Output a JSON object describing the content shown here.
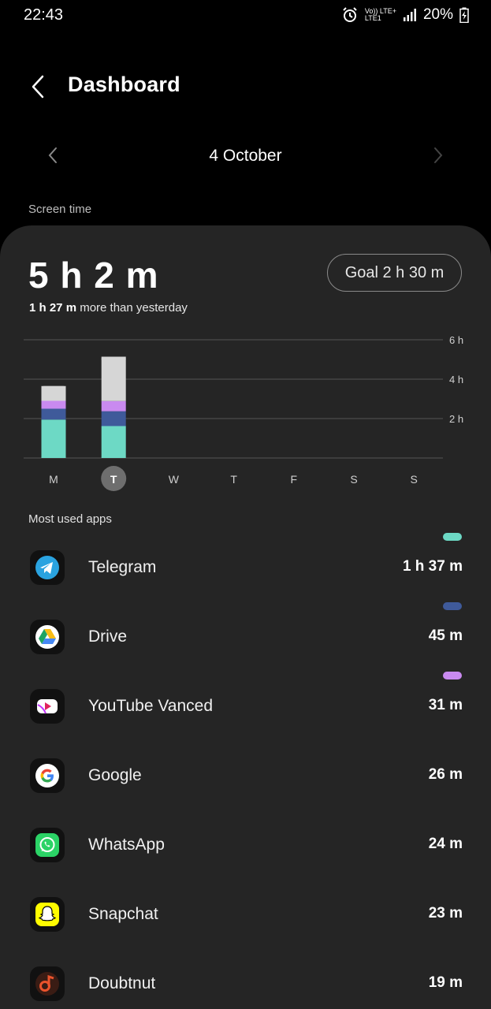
{
  "status": {
    "time": "22:43",
    "net_top": "Vo)) LTE+",
    "net_bottom": "LTE1",
    "battery": "20%"
  },
  "header": {
    "title": "Dashboard"
  },
  "date_nav": {
    "date": "4 October"
  },
  "screen_time": {
    "section_label": "Screen time",
    "total": "5 h 2 m",
    "compare_bold": "1 h 27 m",
    "compare_rest": " more than yesterday",
    "goal_label": "Goal 2 h 30 m"
  },
  "colors": {
    "telegram": "#6dd9c5",
    "drive": "#3f5a9a",
    "youtube_vanced": "#c98af0",
    "other": "#d6d6d6"
  },
  "chart_data": {
    "type": "bar",
    "categories": [
      "M",
      "T",
      "W",
      "T",
      "F",
      "S",
      "S"
    ],
    "selected_index": 1,
    "ylim": [
      0,
      6
    ],
    "yticks": [
      "2 h",
      "4 h",
      "6 h"
    ],
    "stacked": [
      {
        "segments": [
          {
            "series": "telegram",
            "hours": 1.95
          },
          {
            "series": "drive",
            "hours": 0.55
          },
          {
            "series": "youtube_vanced",
            "hours": 0.4
          },
          {
            "series": "other",
            "hours": 0.75
          }
        ]
      },
      {
        "segments": [
          {
            "series": "telegram",
            "hours": 1.62
          },
          {
            "series": "drive",
            "hours": 0.75
          },
          {
            "series": "youtube_vanced",
            "hours": 0.52
          },
          {
            "series": "other",
            "hours": 2.25
          }
        ]
      },
      {
        "segments": []
      },
      {
        "segments": []
      },
      {
        "segments": []
      },
      {
        "segments": []
      },
      {
        "segments": []
      }
    ]
  },
  "most_used": {
    "section_label": "Most used apps",
    "apps": [
      {
        "name": "Telegram",
        "time": "1 h 37 m",
        "icon": "telegram-icon",
        "tag": "telegram"
      },
      {
        "name": "Drive",
        "time": "45 m",
        "icon": "drive-icon",
        "tag": "drive"
      },
      {
        "name": "YouTube Vanced",
        "time": "31 m",
        "icon": "youtube-vanced-icon",
        "tag": "youtube_vanced"
      },
      {
        "name": "Google",
        "time": "26 m",
        "icon": "google-icon",
        "tag": ""
      },
      {
        "name": "WhatsApp",
        "time": "24 m",
        "icon": "whatsapp-icon",
        "tag": ""
      },
      {
        "name": "Snapchat",
        "time": "23 m",
        "icon": "snapchat-icon",
        "tag": ""
      },
      {
        "name": "Doubtnut",
        "time": "19 m",
        "icon": "doubtnut-icon",
        "tag": ""
      }
    ]
  }
}
